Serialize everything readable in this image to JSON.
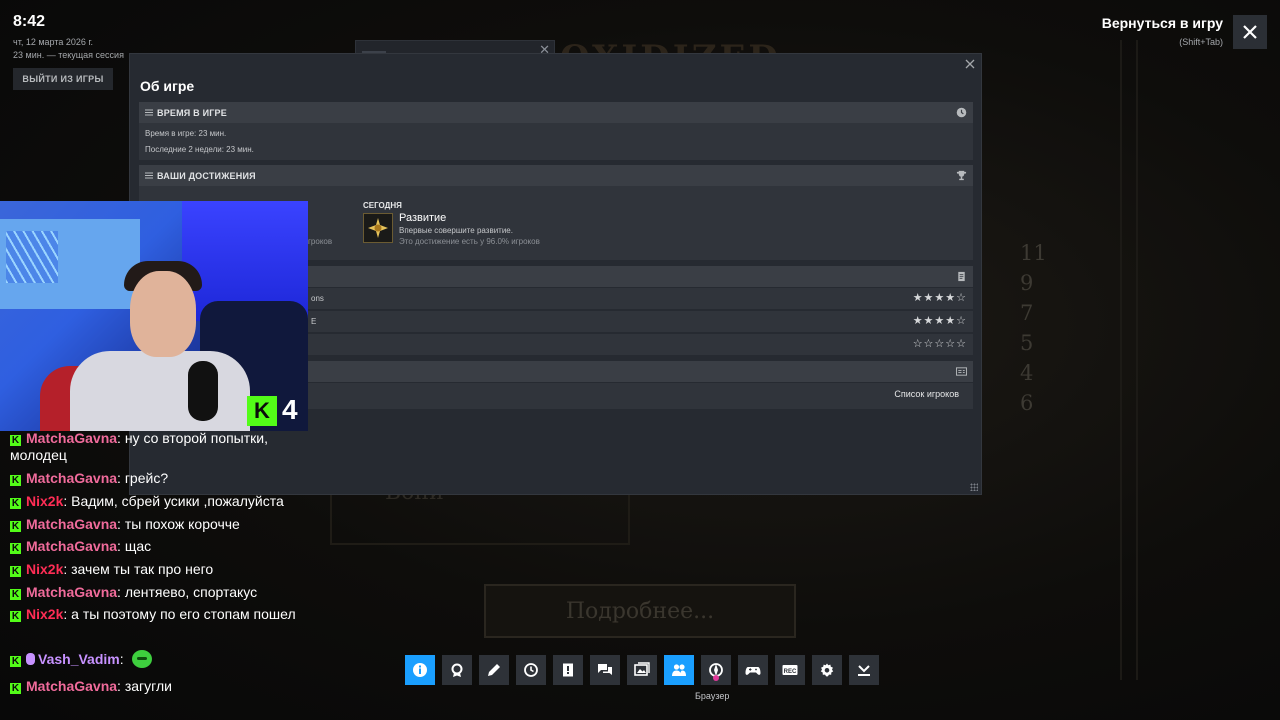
{
  "overlay": {
    "clock": "8:42",
    "date": "чт, 12 марта 2026 г.",
    "session": "23 мин. — текущая сессия",
    "exit_button": "ВЫЙТИ ИЗ ИГРЫ",
    "return_label": "Вернуться в игру",
    "return_hint": "(Shift+Tab)"
  },
  "game_background": {
    "numbers": [
      "11",
      "9",
      "7",
      "5",
      "4",
      "6"
    ],
    "button_text": "Подробнее...",
    "panel_text": "Вони"
  },
  "panel": {
    "title": "Об игре",
    "playtime": {
      "header": "ВРЕМЯ В ИГРЕ",
      "total": "Время в игре: 23 мин.",
      "last_two_weeks": "Последние 2 недели: 23 мин."
    },
    "achievements": {
      "header": "ВАШИ ДОСТИЖЕНИЯ",
      "hidden_fragment": "гроков",
      "when": "СЕГОДНЯ",
      "name": "Развитие",
      "description": "Впервые совершите развитие.",
      "rarity": "Это достижение есть у 96.0% игроков"
    },
    "reviews": [
      {
        "name": "ons",
        "stars": "★★★★☆"
      },
      {
        "name": "E",
        "stars": "★★★★☆"
      },
      {
        "name": "",
        "stars": "☆☆☆☆☆"
      }
    ],
    "players_link": "Список игроков"
  },
  "stream": {
    "badge_letter": "K",
    "badge_number": "4"
  },
  "chat": [
    {
      "user": "MatchaGavna",
      "role": "matcha",
      "text": "ну со второй попытки, молодец"
    },
    {
      "user": "MatchaGavna",
      "role": "matcha",
      "text": "грейс?"
    },
    {
      "user": "Nix2k",
      "role": "nix",
      "text": "Вадим, сбрей усики ,пожалуйста"
    },
    {
      "user": "MatchaGavna",
      "role": "matcha",
      "text": "ты похож корочче"
    },
    {
      "user": "MatchaGavna",
      "role": "matcha",
      "text": "щас"
    },
    {
      "user": "Nix2k",
      "role": "nix",
      "text": "зачем ты так про него"
    },
    {
      "user": "MatchaGavna",
      "role": "matcha",
      "text": "лентяево, спортакус"
    },
    {
      "user": "Nix2k",
      "role": "nix",
      "text": "а ты поэтому по его стопам пошел"
    },
    {
      "user": "Vash_Vadim",
      "role": "vash",
      "text": ""
    },
    {
      "user": "MatchaGavna",
      "role": "matcha",
      "text": "загугли"
    }
  ],
  "toolbar": {
    "tooltip": "Браузер",
    "buttons": [
      "info-icon",
      "achievements-icon",
      "notes-icon",
      "timer-icon",
      "guides-icon",
      "chat-icon",
      "screenshots-icon",
      "friends-icon",
      "browser-icon",
      "controller-icon",
      "recording-icon",
      "settings-icon",
      "downloads-icon"
    ]
  },
  "colors": {
    "accent": "#1a9fff",
    "kick_green": "#53fc18",
    "matcha": "#f06b9b",
    "nix": "#ff2d55",
    "vash": "#c792ff"
  }
}
